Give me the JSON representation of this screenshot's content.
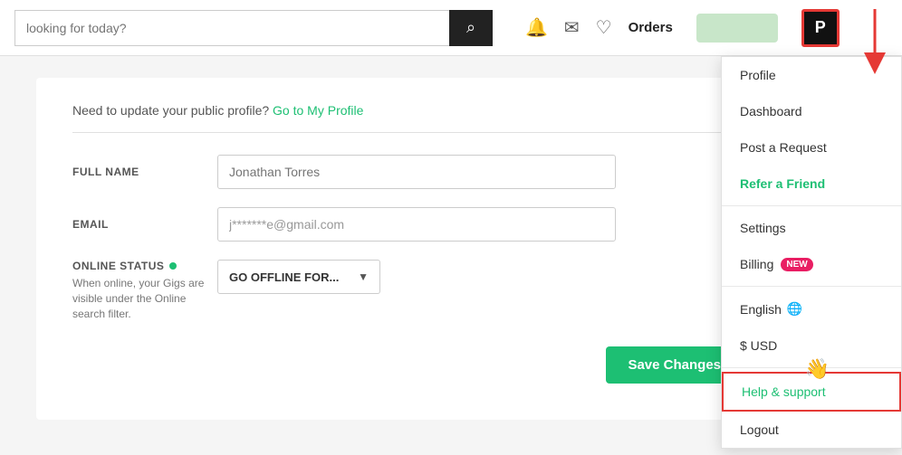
{
  "header": {
    "search_placeholder": "looking for today?",
    "search_icon": "🔍",
    "bell_icon": "🔔",
    "mail_icon": "✉",
    "heart_icon": "♡",
    "orders_label": "Orders",
    "profile_letter": "P"
  },
  "profile_notice": {
    "text": "Need to update your public profile?",
    "link_text": "Go to My Profile"
  },
  "form": {
    "full_name_label": "FULL NAME",
    "full_name_value": "",
    "full_name_placeholder": "Jonathan Torres",
    "email_label": "EMAIL",
    "email_value": "j*******e@gmail.com",
    "online_status_label": "ONLINE STATUS",
    "online_desc": "When online, your Gigs are visible under the Online search filter.",
    "offline_btn_label": "GO OFFLINE FOR...",
    "save_btn_label": "Save Changes"
  },
  "dropdown": {
    "items": [
      {
        "id": "profile",
        "label": "Profile",
        "special": ""
      },
      {
        "id": "dashboard",
        "label": "Dashboard",
        "special": ""
      },
      {
        "id": "post-request",
        "label": "Post a Request",
        "special": ""
      },
      {
        "id": "refer",
        "label": "Refer a Friend",
        "special": "refer"
      },
      {
        "id": "settings",
        "label": "Settings",
        "special": ""
      },
      {
        "id": "billing",
        "label": "Billing",
        "special": "new"
      },
      {
        "id": "language",
        "label": "English",
        "special": "lang"
      },
      {
        "id": "currency",
        "label": "$ USD",
        "special": ""
      },
      {
        "id": "help",
        "label": "Help & support",
        "special": "help"
      },
      {
        "id": "logout",
        "label": "Logout",
        "special": ""
      }
    ]
  }
}
